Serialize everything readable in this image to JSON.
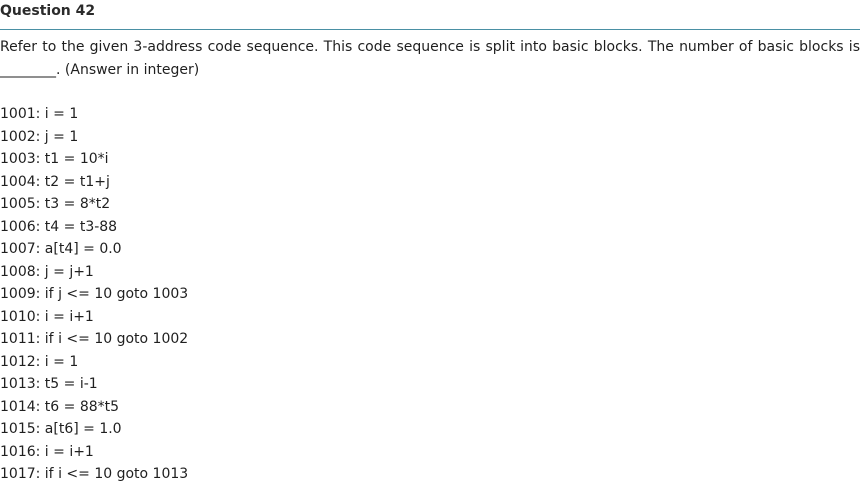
{
  "question": {
    "title": "Question 42",
    "text_before": "Refer to the given 3-address code sequence. This code sequence is split into basic blocks. The number of basic blocks is ",
    "blank": "________",
    "text_after": ". (Answer in integer)"
  },
  "code_lines": [
    "1001: i = 1",
    "1002: j = 1",
    "1003: t1 = 10*i",
    "1004: t2 = t1+j",
    "1005: t3 = 8*t2",
    "1006: t4 = t3-88",
    "1007: a[t4] = 0.0",
    "1008: j = j+1",
    "1009: if j <= 10 goto 1003",
    "1010: i = i+1",
    "1011: if i <= 10 goto 1002",
    "1012: i = 1",
    "1013: t5 = i-1",
    "1014: t6 = 88*t5",
    "1015: a[t6] = 1.0",
    "1016: i = i+1",
    "1017: if i <= 10 goto 1013"
  ]
}
